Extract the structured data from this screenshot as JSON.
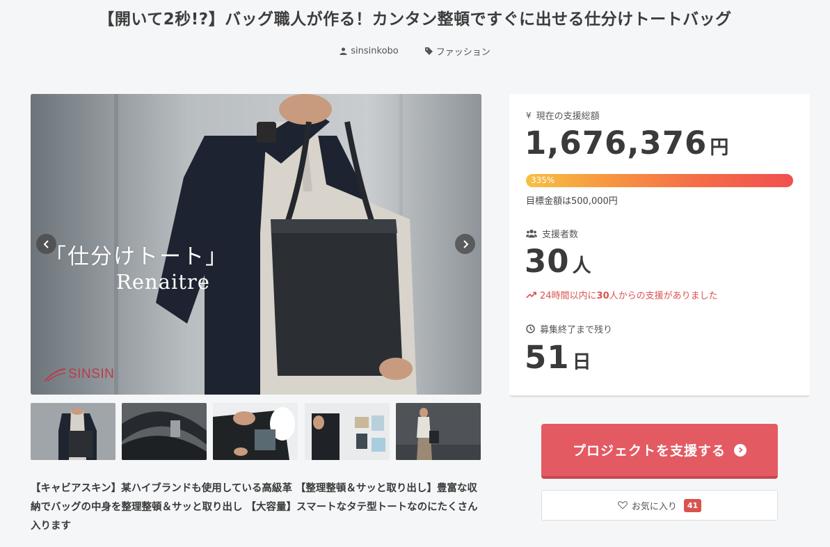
{
  "project": {
    "title": "【開いて2秒!?】バッグ職人が作る！カンタン整頓ですぐに出せる仕分けトートバッグ",
    "owner": "sinsinkobo",
    "category": "ファッション"
  },
  "hero": {
    "caption_line1": "「仕分けトート」",
    "caption_line2": "Renaitre",
    "brand": "SINSIN"
  },
  "thumbnails": [
    "thumb-1",
    "thumb-2",
    "thumb-3",
    "thumb-4",
    "thumb-5"
  ],
  "description": "【キャビアスキン】某ハイブランドも使用している高級革 【整理整頓＆サッと取り出し】豊富な収納でバッグの中身を整理整頓＆サッと取り出し 【大容量】スマートなタテ型トートなのにたくさん入ります",
  "stats": {
    "amount_label": "現在の支援総額",
    "amount": "1,676,376",
    "amount_unit": "円",
    "progress_text": "335%",
    "progress_percent": 335,
    "goal": "目標金額は500,000円",
    "backers_label": "支援者数",
    "backers": "30",
    "backers_unit": "人",
    "recent_prefix": "24時間以内に",
    "recent_count": "30",
    "recent_suffix": "人からの支援がありました",
    "remaining_label": "募集終了まで残り",
    "remaining": "51",
    "remaining_unit": "日"
  },
  "actions": {
    "support_label": "プロジェクトを支援する",
    "favorite_label": "お気に入り",
    "favorite_count": "41"
  },
  "colors": {
    "accent": "#e35a63",
    "recent": "#d9534f",
    "progress_start": "#f7c041",
    "progress_end": "#f15050"
  }
}
